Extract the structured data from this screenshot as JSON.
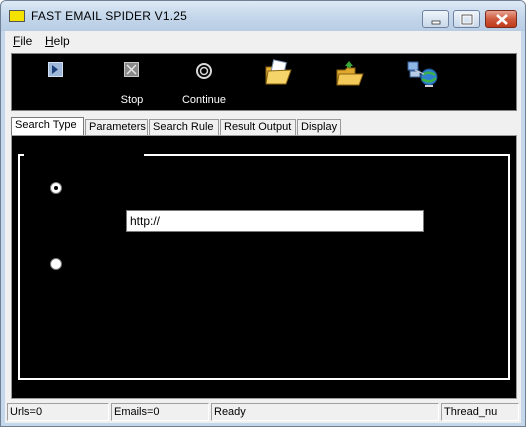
{
  "window": {
    "title": "FAST EMAIL SPIDER  V1.25",
    "minimize_label": "",
    "maximize_label": "",
    "close_label": ""
  },
  "menu": [
    {
      "label": "File",
      "accel": "F",
      "rest": "ile"
    },
    {
      "label": "Help",
      "accel": "H",
      "rest": "elp"
    }
  ],
  "toolbar": {
    "buttons": [
      {
        "name": "start",
        "icon": "start-icon",
        "label": ""
      },
      {
        "name": "stop",
        "icon": "stop-icon",
        "label": "Stop"
      },
      {
        "name": "continue",
        "icon": "continue-icon",
        "label": "Continue"
      },
      {
        "name": "open",
        "icon": "open-folder-icon",
        "label": ""
      },
      {
        "name": "export",
        "icon": "export-folder-icon",
        "label": ""
      },
      {
        "name": "network",
        "icon": "network-globe-icon",
        "label": ""
      }
    ]
  },
  "tabs": [
    {
      "label": "Search Type",
      "active": true
    },
    {
      "label": "Parameters",
      "active": false
    },
    {
      "label": "Search Rule",
      "active": false
    },
    {
      "label": "Result Output",
      "active": false
    },
    {
      "label": "Display",
      "active": false
    }
  ],
  "search_type": {
    "url_input_value": "http://",
    "radio_1_selected": true,
    "radio_2_selected": false
  },
  "status": {
    "urls": "Urls=0",
    "emails": "Emails=0",
    "state": "Ready",
    "threads": "Thread_nu"
  },
  "colors": {
    "title_gradient_top": "#dde9f6",
    "close_red": "#c03a1c",
    "panel_black": "#000000"
  }
}
